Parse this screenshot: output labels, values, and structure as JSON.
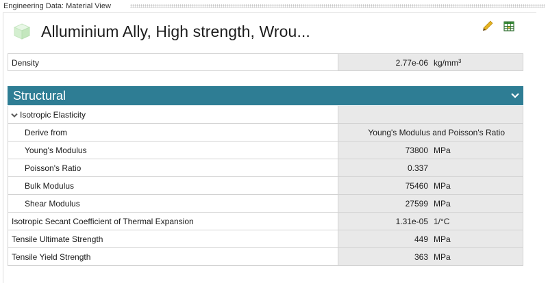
{
  "pane": {
    "title": "Engineering Data: Material View"
  },
  "material": {
    "name": "Alluminium Ally, High strength, Wrou..."
  },
  "density": {
    "label": "Density",
    "value": "2.77e-06",
    "unit_base": "kg/mm",
    "unit_exp": "3"
  },
  "section": {
    "title": "Structural"
  },
  "isotropic": {
    "label": "Isotropic Elasticity"
  },
  "derive": {
    "label": "Derive from",
    "value": "Young's Modulus and Poisson's Ratio"
  },
  "youngs": {
    "label": "Young's Modulus",
    "value": "73800",
    "unit": "MPa"
  },
  "poisson": {
    "label": "Poisson's Ratio",
    "value": "0.337",
    "unit": ""
  },
  "bulk": {
    "label": "Bulk Modulus",
    "value": "75460",
    "unit": "MPa"
  },
  "shear": {
    "label": "Shear Modulus",
    "value": "27599",
    "unit": "MPa"
  },
  "thermal": {
    "label": "Isotropic Secant Coefficient of Thermal Expansion",
    "value": "1.31e-05",
    "unit": "1/°C"
  },
  "uts": {
    "label": "Tensile Ultimate Strength",
    "value": "449",
    "unit": "MPa"
  },
  "tys": {
    "label": "Tensile Yield Strength",
    "value": "363",
    "unit": "MPa"
  },
  "icons": {
    "material": "material-cube-icon",
    "edit": "pencil-icon",
    "table": "table-grid-icon",
    "collapse": "chevron-down-icon",
    "expander": "expander-triangle-icon"
  },
  "colors": {
    "section_header": "#2e7d94",
    "value_cell": "#e9e9e9",
    "border": "#d2d2d2"
  }
}
